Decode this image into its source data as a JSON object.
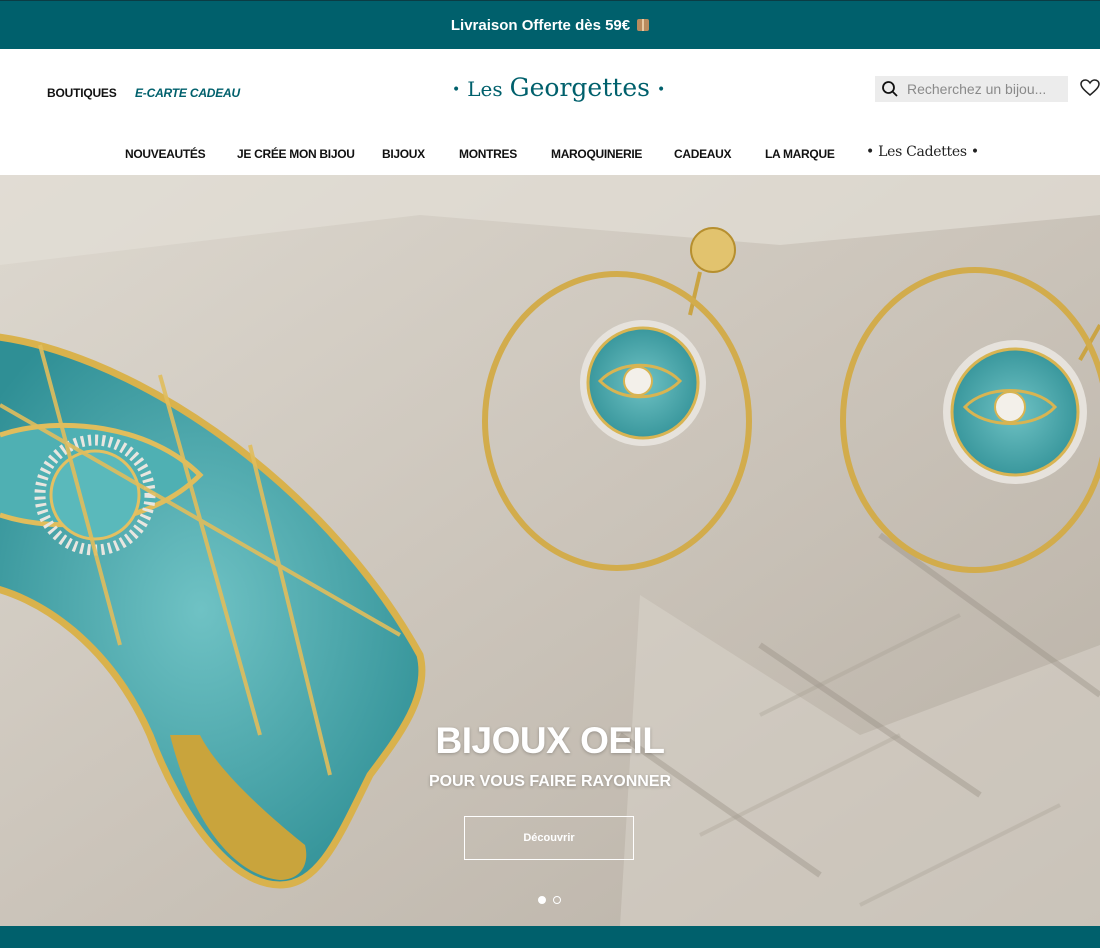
{
  "topbar": {
    "text": "Livraison Offerte dès 59€",
    "icon": "package-icon"
  },
  "header": {
    "left_links": [
      "BOUTIQUES",
      "E-CARTE CADEAU"
    ],
    "logo": {
      "prefix": "•",
      "text_les": "Les",
      "text_brand": "Georgettes",
      "suffix": "•"
    },
    "search_placeholder": "Recherchez un bijou...",
    "wishlist_icon": "heart-icon"
  },
  "nav": {
    "items": [
      "NOUVEAUTÉS",
      "JE CRÉE MON BIJOU",
      "BIJOUX",
      "MONTRES",
      "MAROQUINERIE",
      "CADEAUX",
      "LA MARQUE"
    ],
    "cadettes": "• Les  Cadettes •"
  },
  "hero": {
    "title": "BIJOUX OEIL",
    "subtitle": "POUR VOUS FAIRE RAYONNER",
    "cta": "Découvrir",
    "slides": [
      {
        "active": true
      },
      {
        "active": false
      }
    ]
  },
  "colors": {
    "brand": "#00606c",
    "white": "#ffffff"
  }
}
